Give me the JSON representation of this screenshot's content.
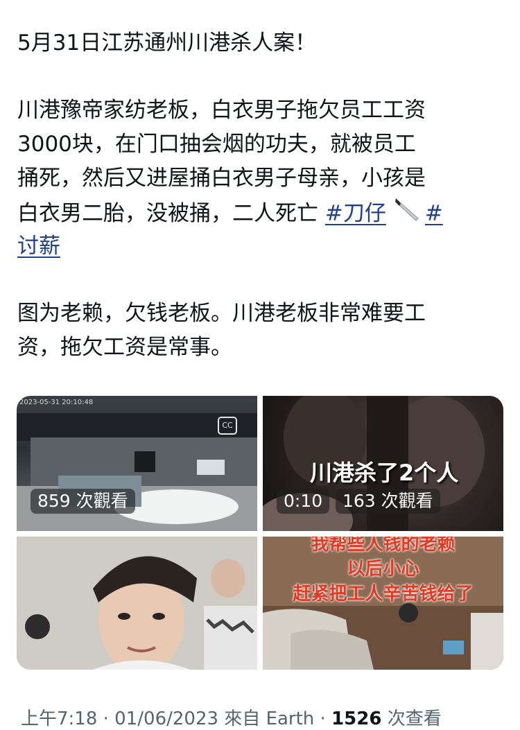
{
  "post": {
    "line1": "5月31日江苏通州川港杀人案！",
    "line2": "川港豫帝家纺老板，白衣男子拖欠员工工资",
    "line3": "3000块，在门口抽会烟的功夫，就被员工",
    "line4": "捅死，然后又进屋捅白衣男子母亲，小孩是",
    "line5_text": "白衣男二胎，没被捅，二人死亡 ",
    "hashtag1": "#刀仔",
    "hashtag2_start": "#",
    "hashtag2_end": "讨薪",
    "line7": "图为老赖，欠钱老板。川港老板非常难要工",
    "line8": "资，拖欠工资是常事。"
  },
  "media": {
    "video1": {
      "timestamp": "2023-05-31 20:10:48",
      "views": "859 次觀看"
    },
    "video2": {
      "overlay": "川港杀了2个人",
      "duration": "0:10",
      "views": "163 次觀看"
    },
    "image4": {
      "lines": [
        "我帮些人钱的老赖",
        "以后小心",
        "赶紧把工人辛苦钱给了"
      ]
    }
  },
  "footer": {
    "time": "上午7:18 · 01/06/2023 來自 Earth · ",
    "count": "1526",
    "suffix": " 次查看"
  },
  "colors": {
    "hashtag": "#1d3f8c",
    "text": "#0f1419",
    "meta": "#536471"
  },
  "icons": {
    "knife": "knife-emoji",
    "captions": "closed-captions-icon"
  }
}
